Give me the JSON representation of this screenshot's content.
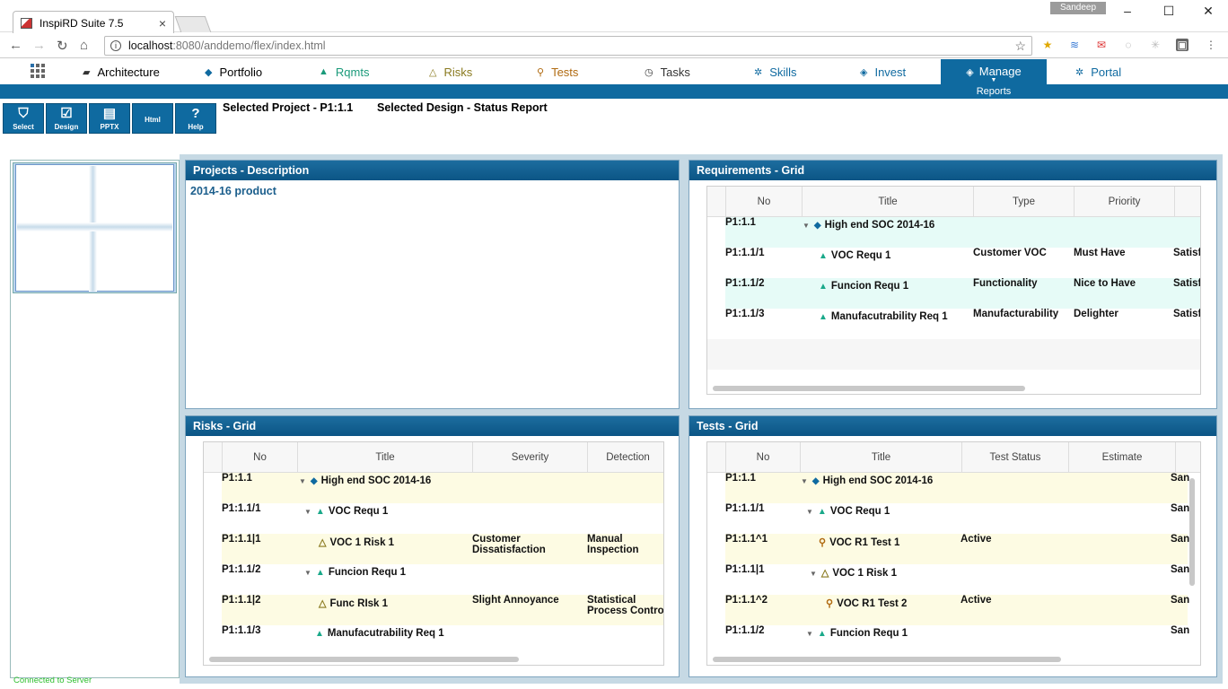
{
  "browser": {
    "tab_title": "InspiRD Suite 7.5",
    "user": "Sandeep",
    "url_host": "localhost",
    "url_rest": ":8080/anddemo/flex/index.html"
  },
  "nav": {
    "items": [
      {
        "label": "Architecture",
        "icon": "folder-icon"
      },
      {
        "label": "Portfolio",
        "icon": "diamond-icon"
      },
      {
        "label": "Rqmts",
        "icon": "triangle-icon"
      },
      {
        "label": "Risks",
        "icon": "warning-icon"
      },
      {
        "label": "Tests",
        "icon": "search-icon"
      },
      {
        "label": "Tasks",
        "icon": "clock-icon"
      },
      {
        "label": "Skills",
        "icon": "gear-icon"
      },
      {
        "label": "Invest",
        "icon": "diamond-icon"
      },
      {
        "label": "Manage",
        "icon": "diamond-icon"
      },
      {
        "label": "Portal",
        "icon": "gear-icon"
      }
    ],
    "manage_sub": "Reports"
  },
  "toolbar": {
    "select": "Select",
    "design": "Design",
    "pptx": "PPTX",
    "html": "Html",
    "help": "Help"
  },
  "selection": {
    "project": "Selected Project - P1:1.1",
    "design": "Selected Design - Status Report"
  },
  "status": "Connected to Server",
  "projects": {
    "title": "Projects - Description",
    "text": "2014-16 product"
  },
  "requirements": {
    "title": "Requirements - Grid",
    "columns": [
      "No",
      "Title",
      "Type",
      "Priority"
    ],
    "rows": [
      {
        "no": "P1:1.1",
        "title": "High end SOC 2014-16",
        "type": "",
        "priority": "",
        "extra": ""
      },
      {
        "no": "P1:1.1/1",
        "title": "VOC Requ 1",
        "type": "Customer VOC",
        "priority": "Must Have",
        "extra": "Satisf"
      },
      {
        "no": "P1:1.1/2",
        "title": "Funcion Requ 1",
        "type": "Functionality",
        "priority": "Nice to Have",
        "extra": "Satisf"
      },
      {
        "no": "P1:1.1/3",
        "title": "Manufacutrability Req 1",
        "type": "Manufacturability",
        "priority": "Delighter",
        "extra": "Satisf"
      }
    ]
  },
  "risks": {
    "title": "Risks - Grid",
    "columns": [
      "No",
      "Title",
      "Severity",
      "Detection"
    ],
    "rows": [
      {
        "no": "P1:1.1",
        "title": "High end SOC 2014-16",
        "severity1": "",
        "severity2": "",
        "detection1": "",
        "detection2": ""
      },
      {
        "no": "P1:1.1/1",
        "title": "VOC Requ 1",
        "severity1": "",
        "severity2": "",
        "detection1": "",
        "detection2": ""
      },
      {
        "no": "P1:1.1|1",
        "title": "VOC 1 Risk 1",
        "severity1": "Customer",
        "severity2": "Dissatisfaction",
        "detection1": "Manual",
        "detection2": "Inspection"
      },
      {
        "no": "P1:1.1/2",
        "title": "Funcion Requ 1",
        "severity1": "",
        "severity2": "",
        "detection1": "",
        "detection2": ""
      },
      {
        "no": "P1:1.1|2",
        "title": "Func RIsk 1",
        "severity1": "Slight Annoyance",
        "severity2": "",
        "detection1": "Statistical",
        "detection2": "Process Contro"
      },
      {
        "no": "P1:1.1/3",
        "title": "Manufacutrability Req 1",
        "severity1": "",
        "severity2": "",
        "detection1": "",
        "detection2": ""
      }
    ]
  },
  "tests": {
    "title": "Tests - Grid",
    "columns": [
      "No",
      "Title",
      "Test Status",
      "Estimate"
    ],
    "rows": [
      {
        "no": "P1:1.1",
        "title": "High end SOC 2014-16",
        "status": "",
        "extra": "San"
      },
      {
        "no": "P1:1.1/1",
        "title": "VOC Requ 1",
        "status": "",
        "extra": "San"
      },
      {
        "no": "P1:1.1^1",
        "title": "VOC R1 Test 1",
        "status": "Active",
        "extra": "San"
      },
      {
        "no": "P1:1.1|1",
        "title": "VOC 1 Risk 1",
        "status": "",
        "extra": "San"
      },
      {
        "no": "P1:1.1^2",
        "title": "VOC R1 Test 2",
        "status": "Active",
        "extra": "San"
      },
      {
        "no": "P1:1.1/2",
        "title": "Funcion Requ 1",
        "status": "",
        "extra": "San"
      }
    ]
  },
  "colors": {
    "brand": "#0f6aa0",
    "req_row_alt": "#e6fbf7",
    "risk_row_alt": "#fdfbe3",
    "status_text": "#2fbf2f"
  }
}
